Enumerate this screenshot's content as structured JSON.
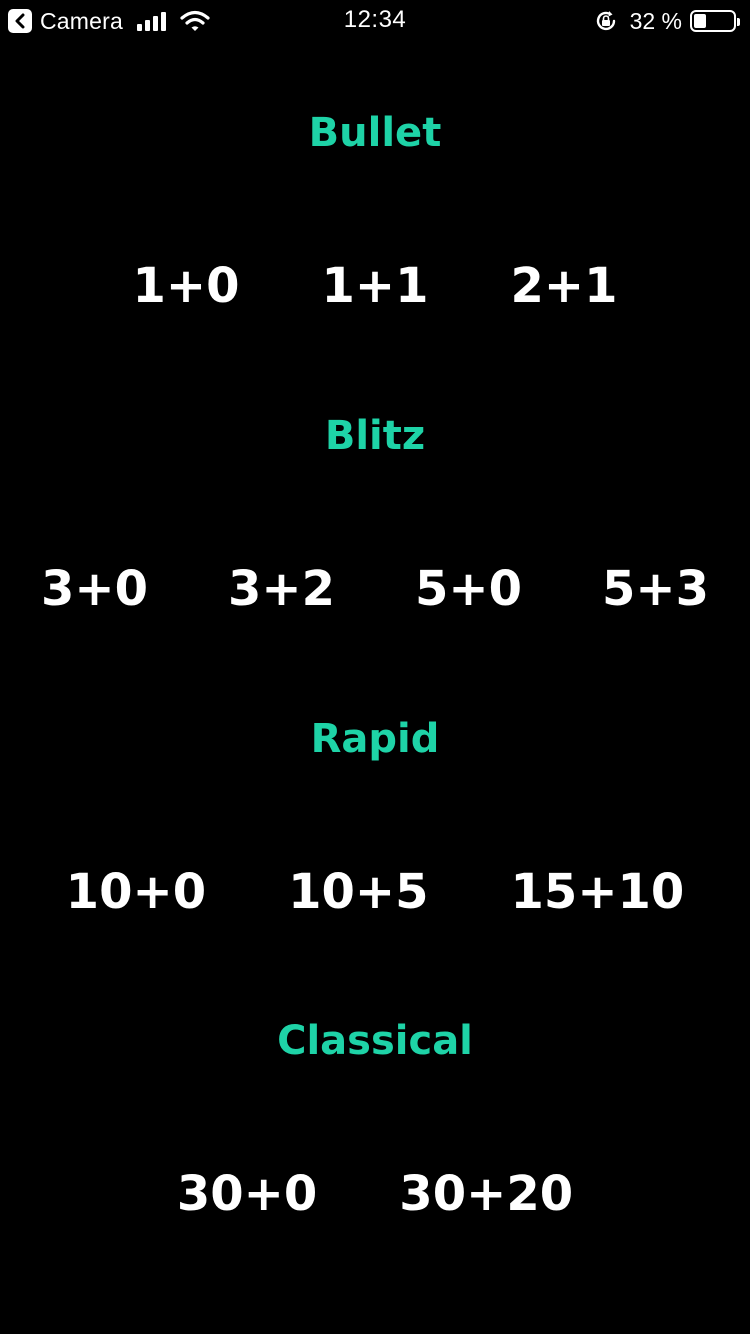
{
  "status_bar": {
    "back_label": "Camera",
    "time": "12:34",
    "battery_percent": "32 %",
    "battery_level": 0.32
  },
  "categories": [
    {
      "title": "Bullet",
      "controls": [
        "1+0",
        "1+1",
        "2+1"
      ]
    },
    {
      "title": "Blitz",
      "controls": [
        "3+0",
        "3+2",
        "5+0",
        "5+3"
      ]
    },
    {
      "title": "Rapid",
      "controls": [
        "10+0",
        "10+5",
        "15+10"
      ]
    },
    {
      "title": "Classical",
      "controls": [
        "30+0",
        "30+20"
      ]
    }
  ],
  "colors": {
    "background": "#000000",
    "accent": "#1ed3a7",
    "text": "#ffffff"
  }
}
